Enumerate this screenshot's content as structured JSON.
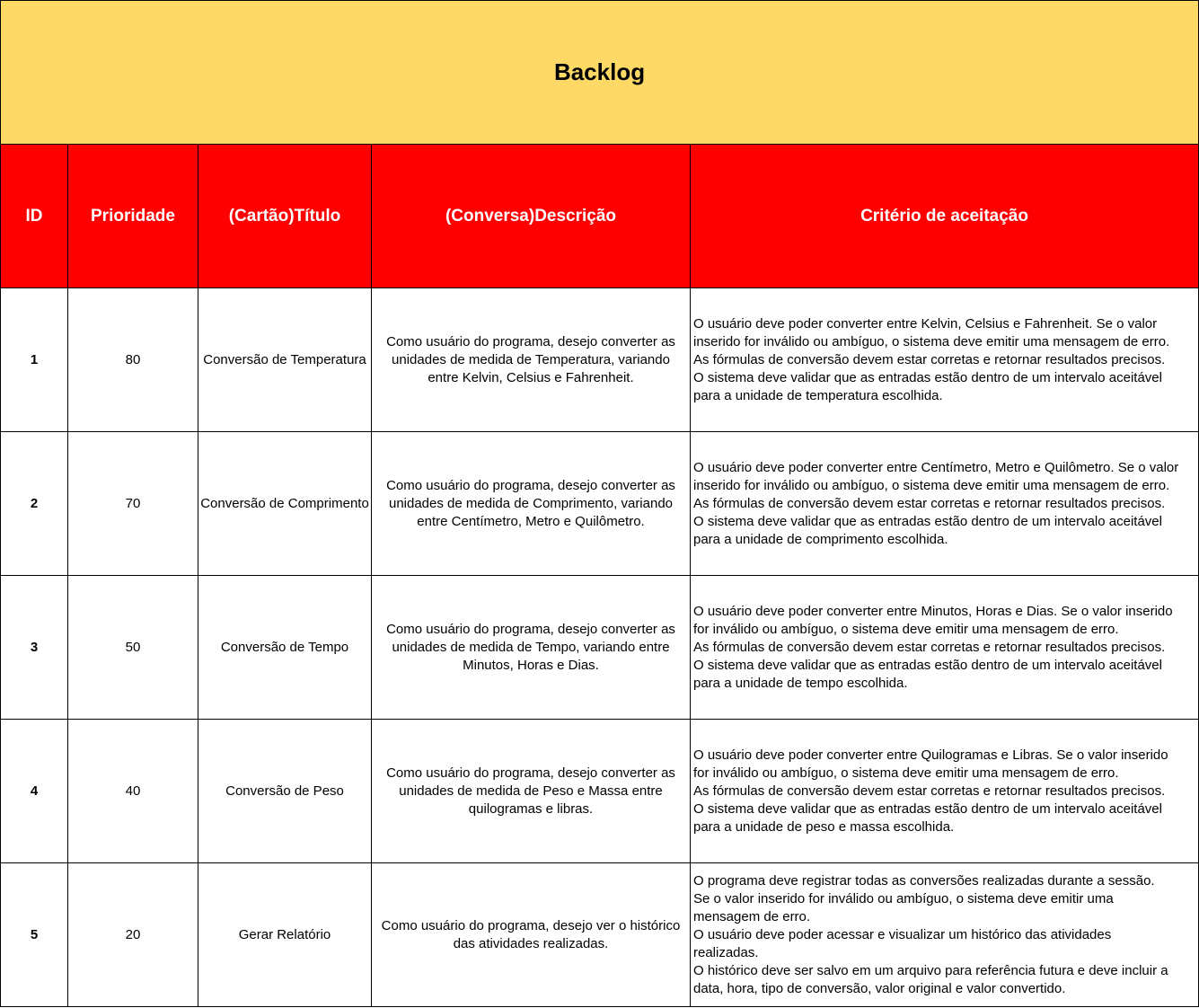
{
  "title": "Backlog",
  "headers": [
    "ID",
    "Prioridade",
    "(Cartão)Título",
    "(Conversa)Descrição",
    "Critério de aceitação"
  ],
  "colors": {
    "title_bg": "#ffd966",
    "header_bg": "#ff0000",
    "header_text": "#ffffff"
  },
  "rows": [
    {
      "id": "1",
      "priority": "80",
      "title": "Conversão de Temperatura",
      "description": "Como usuário do programa, desejo converter as unidades de medida de Temperatura, variando entre Kelvin, Celsius e Fahrenheit.",
      "criteria": [
        "O usuário deve poder converter entre Kelvin, Celsius e Fahrenheit. Se o valor",
        "inserido for inválido ou ambíguo, o sistema deve emitir uma mensagem de erro.",
        "As fórmulas de conversão devem estar corretas e retornar resultados precisos.",
        "O sistema deve validar que as entradas estão dentro de um intervalo aceitável",
        "para a unidade de temperatura escolhida."
      ]
    },
    {
      "id": "2",
      "priority": "70",
      "title": "Conversão de Comprimento",
      "description": "Como usuário do programa, desejo converter as unidades de medida de Comprimento, variando entre Centímetro, Metro e Quilômetro.",
      "criteria": [
        "O usuário deve poder converter entre Centímetro, Metro e Quilômetro. Se o valor",
        "inserido for inválido ou ambíguo, o sistema deve emitir uma mensagem de erro.",
        "As fórmulas de conversão devem estar corretas e retornar resultados precisos.",
        "O sistema deve validar que as entradas estão dentro de um intervalo aceitável",
        "para a unidade de comprimento escolhida."
      ]
    },
    {
      "id": "3",
      "priority": "50",
      "title": "Conversão de Tempo",
      "description": "Como usuário do programa, desejo converter as unidades de medida de Tempo, variando entre Minutos, Horas e Dias.",
      "criteria": [
        "O usuário deve poder converter entre Minutos, Horas e Dias. Se o valor inserido",
        "for inválido ou ambíguo, o sistema deve emitir uma mensagem de erro.",
        "As fórmulas de conversão devem estar corretas e retornar resultados precisos.",
        "O sistema deve validar que as entradas estão dentro de um intervalo aceitável",
        "para a unidade de tempo escolhida."
      ]
    },
    {
      "id": "4",
      "priority": "40",
      "title": "Conversão de Peso",
      "description": "Como usuário do programa, desejo converter as unidades de medida de Peso e Massa entre quilogramas e libras.",
      "criteria": [
        "O usuário deve poder converter entre Quilogramas e Libras. Se o valor inserido",
        "for inválido ou ambíguo, o sistema deve emitir uma mensagem de erro.",
        "As fórmulas de conversão devem estar corretas e retornar resultados precisos.",
        "O sistema deve validar que as entradas estão dentro de um intervalo aceitável",
        "para a unidade de peso e massa escolhida."
      ]
    },
    {
      "id": "5",
      "priority": "20",
      "title": "Gerar Relatório",
      "description": "Como usuário do programa, desejo ver o histórico das atividades realizadas.",
      "criteria": [
        "O programa deve registrar todas as conversões realizadas durante a sessão.",
        "Se o valor inserido for inválido ou ambíguo, o sistema deve emitir uma",
        "mensagem de erro.",
        "O usuário deve poder acessar e visualizar um histórico das atividades",
        "realizadas.",
        "O histórico deve ser salvo em um arquivo para referência futura e deve incluir a",
        "data, hora, tipo de conversão, valor original e valor convertido."
      ]
    }
  ]
}
